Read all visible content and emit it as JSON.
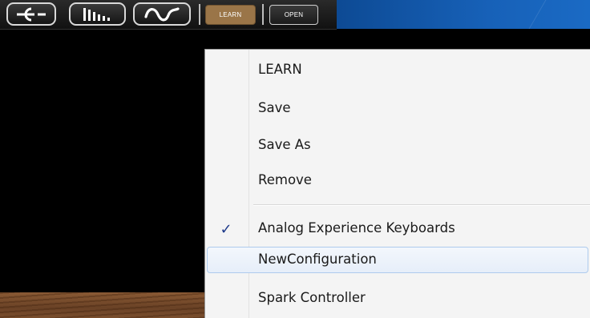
{
  "toolbar": {
    "icons": [
      "signal-input-icon",
      "bars-meter-icon",
      "waveform-icon"
    ],
    "learn_label": "LEARN",
    "open_label": "OPEN"
  },
  "menu": {
    "actions": [
      {
        "label": "LEARN"
      },
      {
        "label": "Save"
      },
      {
        "label": "Save As"
      },
      {
        "label": "Remove"
      }
    ],
    "configurations": [
      {
        "label": "Analog Experience Keyboards",
        "checked": true
      },
      {
        "label": "NewConfiguration",
        "checked": false,
        "hovered": true
      },
      {
        "label": "Spark Controller",
        "checked": false
      }
    ],
    "check_glyph": "✓"
  },
  "colors": {
    "learn_button": "#9a7548",
    "header_blue": "#1761b8",
    "menu_bg": "#f4f4f4",
    "hover_border": "#aecbed",
    "check": "#1e3a8a"
  }
}
